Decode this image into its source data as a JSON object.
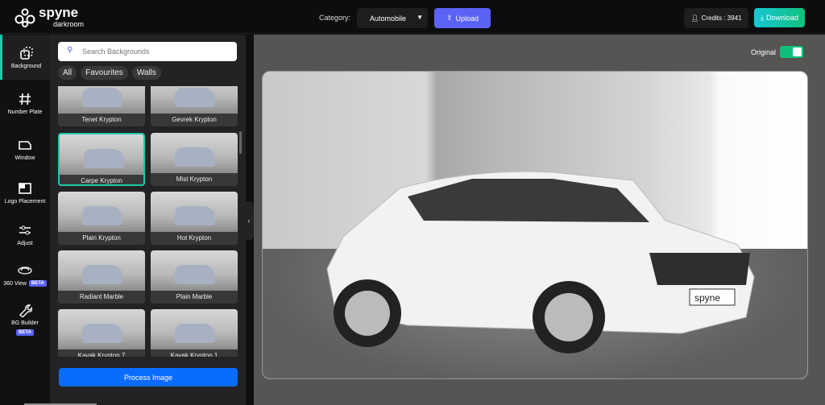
{
  "header": {
    "brand": "spyne",
    "brand_sub": "darkroom",
    "category_label": "Category:",
    "category_value": "Automobile",
    "upload": "Upload",
    "credits": "Credits : 3941",
    "download": "Download"
  },
  "sidebar": {
    "items": [
      {
        "label": "Background"
      },
      {
        "label": "Number Plate"
      },
      {
        "label": "Window"
      },
      {
        "label": "Logo Placement"
      },
      {
        "label": "Adjust"
      },
      {
        "label": "360 View",
        "badge": "BETA"
      },
      {
        "label": "BG Builder",
        "badge": "BETA"
      }
    ]
  },
  "panel": {
    "search_placeholder": "Search Backgrounds",
    "filters": [
      "All",
      "Favourites",
      "Walls"
    ],
    "backgrounds": [
      {
        "label": "Tenet Krypton"
      },
      {
        "label": "Gevrek Krypton"
      },
      {
        "label": "Carpe Krypton",
        "selected": true
      },
      {
        "label": "Mist Krypton"
      },
      {
        "label": "Plain Krypton"
      },
      {
        "label": "Hot Krypton"
      },
      {
        "label": "Radiant Marble"
      },
      {
        "label": "Plain Marble"
      },
      {
        "label": "Kavak Krypton 7"
      },
      {
        "label": "Kavak Krypton 1"
      }
    ],
    "process": "Process Image"
  },
  "main": {
    "original_label": "Original",
    "original_on": true,
    "plate_text": "spyne"
  },
  "colors": {
    "accent": "#5b63f6",
    "teal": "#1fc9a8",
    "process": "#0a6cff",
    "toggle": "#10c07a"
  }
}
